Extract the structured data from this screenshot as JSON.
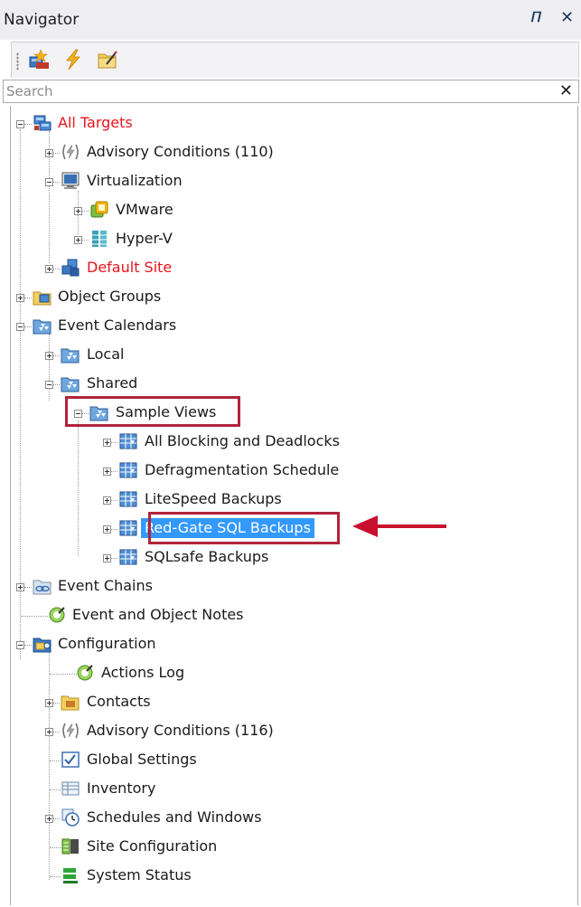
{
  "panel": {
    "title": "Navigator",
    "pin_glyph": "↕",
    "close_glyph": "✕"
  },
  "search": {
    "placeholder": "Search",
    "value": "",
    "clear_glyph": "✕"
  },
  "toolbar": {
    "buttons": [
      "new-target-icon",
      "lightning-icon",
      "folder-edit-icon"
    ]
  },
  "tree": [
    {
      "label": "All Targets",
      "icon": "all-targets-icon",
      "color": "#e8141b"
    },
    {
      "label": "Advisory Conditions (110)",
      "icon": "advisory-icon"
    },
    {
      "label": "Virtualization",
      "icon": "monitor-icon"
    },
    {
      "label": "VMware",
      "icon": "vmware-icon"
    },
    {
      "label": "Hyper-V",
      "icon": "hyperv-icon"
    },
    {
      "label": "Default Site",
      "icon": "site-icon",
      "color": "#e8141b"
    },
    {
      "label": "Object Groups",
      "icon": "object-groups-icon"
    },
    {
      "label": "Event Calendars",
      "icon": "calendar-folder-icon"
    },
    {
      "label": "Local",
      "icon": "calendar-folder-icon"
    },
    {
      "label": "Shared",
      "icon": "calendar-folder-icon"
    },
    {
      "label": "Sample Views",
      "icon": "calendar-folder-icon"
    },
    {
      "label": "All Blocking and Deadlocks",
      "icon": "calendar-view-icon"
    },
    {
      "label": "Defragmentation Schedule",
      "icon": "calendar-view-icon"
    },
    {
      "label": "LiteSpeed Backups",
      "icon": "calendar-view-icon"
    },
    {
      "label": "Red-Gate SQL Backups",
      "icon": "calendar-view-icon",
      "selected": true
    },
    {
      "label": "SQLsafe Backups",
      "icon": "calendar-view-icon"
    },
    {
      "label": "Event Chains",
      "icon": "event-chains-icon"
    },
    {
      "label": "Event and Object Notes",
      "icon": "notes-icon"
    },
    {
      "label": "Configuration",
      "icon": "configuration-icon"
    },
    {
      "label": "Actions Log",
      "icon": "notes-icon"
    },
    {
      "label": "Contacts",
      "icon": "contacts-icon"
    },
    {
      "label": "Advisory Conditions (116)",
      "icon": "advisory-icon"
    },
    {
      "label": "Global Settings",
      "icon": "checkbox-settings-icon"
    },
    {
      "label": "Inventory",
      "icon": "inventory-icon"
    },
    {
      "label": "Schedules and Windows",
      "icon": "schedule-icon"
    },
    {
      "label": "Site Configuration",
      "icon": "site-config-icon"
    },
    {
      "label": "System Status",
      "icon": "system-status-icon"
    }
  ],
  "colors": {
    "highlight_box": "#b0243a",
    "selection": "#3399ff",
    "arrow": "#c8102e"
  }
}
